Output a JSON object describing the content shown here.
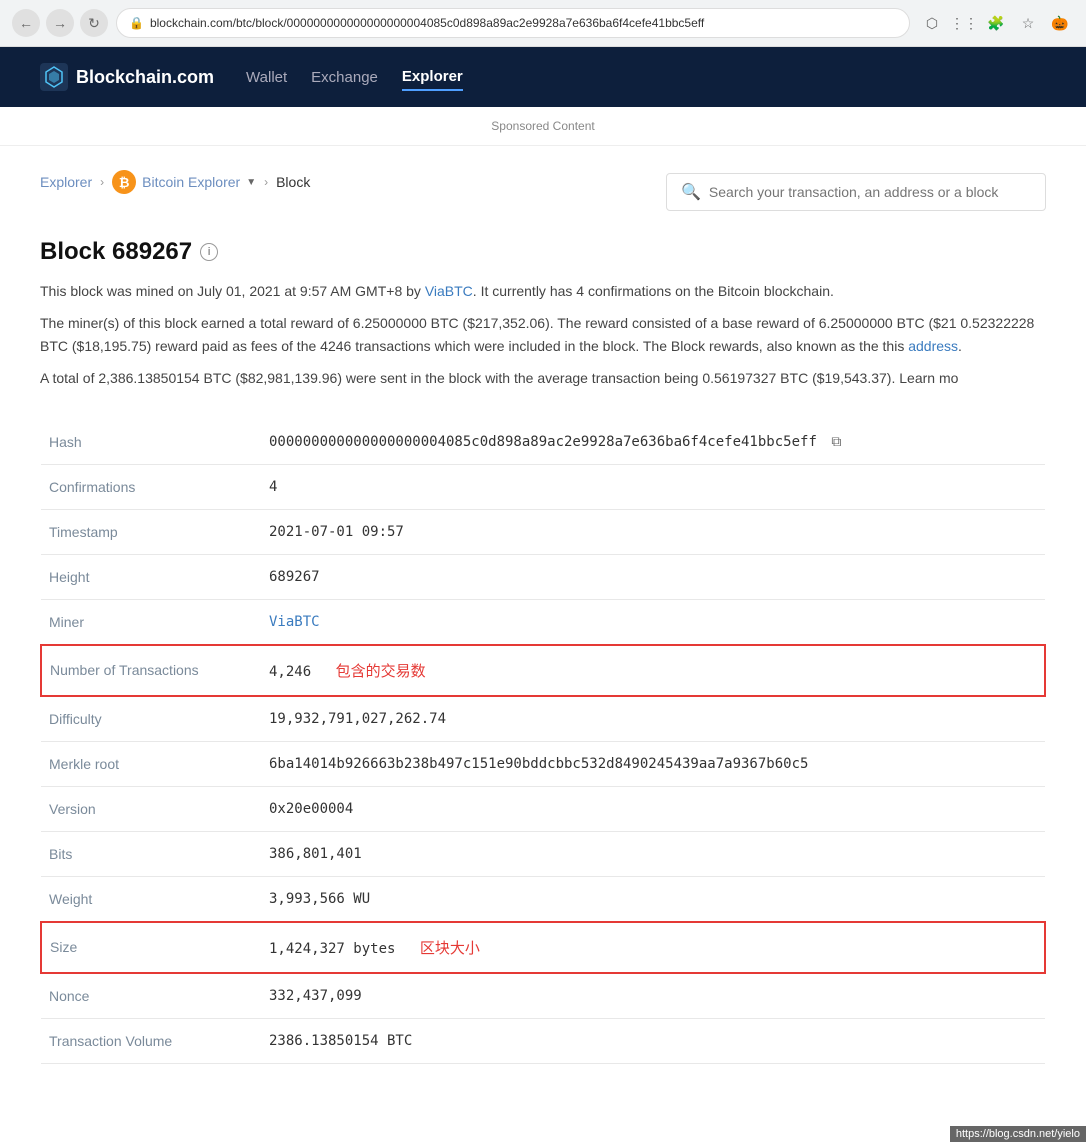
{
  "browser": {
    "url": "blockchain.com/btc/block/000000000000000000004085c0d898a89ac2e9928a7e636ba6f4cefe41bbc5eff",
    "back_icon": "←",
    "forward_icon": "→",
    "refresh_icon": "↻"
  },
  "navbar": {
    "logo_text": "Blockchain.com",
    "links": [
      {
        "label": "Wallet",
        "active": false
      },
      {
        "label": "Exchange",
        "active": false
      },
      {
        "label": "Explorer",
        "active": true
      }
    ]
  },
  "sponsored": "Sponsored Content",
  "breadcrumb": {
    "items": [
      {
        "label": "Explorer",
        "link": true
      },
      {
        "label": "Bitcoin Explorer",
        "link": true,
        "btc_icon": true,
        "has_dropdown": true
      },
      {
        "label": "Block",
        "link": false
      }
    ]
  },
  "search": {
    "placeholder": "Search your transaction, an address or a block"
  },
  "block": {
    "title": "Block 689267",
    "description1": "This block was mined on July 01, 2021 at 9:57 AM GMT+8 by ViaBTC. It currently has 4 confirmations on the Bitcoin blockchain.",
    "description2": "The miner(s) of this block earned a total reward of 6.25000000 BTC ($217,352.06). The reward consisted of a base reward of 6.25000000 BTC ($21 0.52322228 BTC ($18,195.75) reward paid as fees of the 4246 transactions which were included in the block. The Block rewards, also known as the this address.",
    "description3": "A total of 2,386.13850154 BTC ($82,981,139.96) were sent in the block with the average transaction being 0.56197327 BTC ($19,543.37).  Learn mo"
  },
  "table": {
    "rows": [
      {
        "label": "Hash",
        "value": "000000000000000000004085c0d898a89ac2e9928a7e636ba6f4cefe41bbc5eff",
        "has_copy": true,
        "highlight": false,
        "annotation": null
      },
      {
        "label": "Confirmations",
        "value": "4",
        "has_copy": false,
        "highlight": false,
        "annotation": null
      },
      {
        "label": "Timestamp",
        "value": "2021-07-01 09:57",
        "has_copy": false,
        "highlight": false,
        "annotation": null
      },
      {
        "label": "Height",
        "value": "689267",
        "has_copy": false,
        "highlight": false,
        "annotation": null
      },
      {
        "label": "Miner",
        "value": "ViaBTC",
        "is_link": true,
        "has_copy": false,
        "highlight": false,
        "annotation": null
      },
      {
        "label": "Number of Transactions",
        "value": "4,246",
        "has_copy": false,
        "highlight": true,
        "annotation": "包含的交易数"
      },
      {
        "label": "Difficulty",
        "value": "19,932,791,027,262.74",
        "has_copy": false,
        "highlight": false,
        "annotation": null
      },
      {
        "label": "Merkle root",
        "value": "6ba14014b926663b238b497c151e90bddcbbc532d8490245439aa7a9367b60c5",
        "has_copy": false,
        "highlight": false,
        "annotation": null
      },
      {
        "label": "Version",
        "value": "0x20e00004",
        "has_copy": false,
        "highlight": false,
        "annotation": null
      },
      {
        "label": "Bits",
        "value": "386,801,401",
        "has_copy": false,
        "highlight": false,
        "annotation": null
      },
      {
        "label": "Weight",
        "value": "3,993,566 WU",
        "has_copy": false,
        "highlight": false,
        "annotation": null
      },
      {
        "label": "Size",
        "value": "1,424,327 bytes",
        "has_copy": false,
        "highlight": true,
        "annotation": "区块大小"
      },
      {
        "label": "Nonce",
        "value": "332,437,099",
        "has_copy": false,
        "highlight": false,
        "annotation": null
      },
      {
        "label": "Transaction Volume",
        "value": "2386.13850154 BTC",
        "has_copy": false,
        "highlight": false,
        "annotation": null
      }
    ]
  },
  "footer_link": "https://blog.csdn.net/yielo"
}
